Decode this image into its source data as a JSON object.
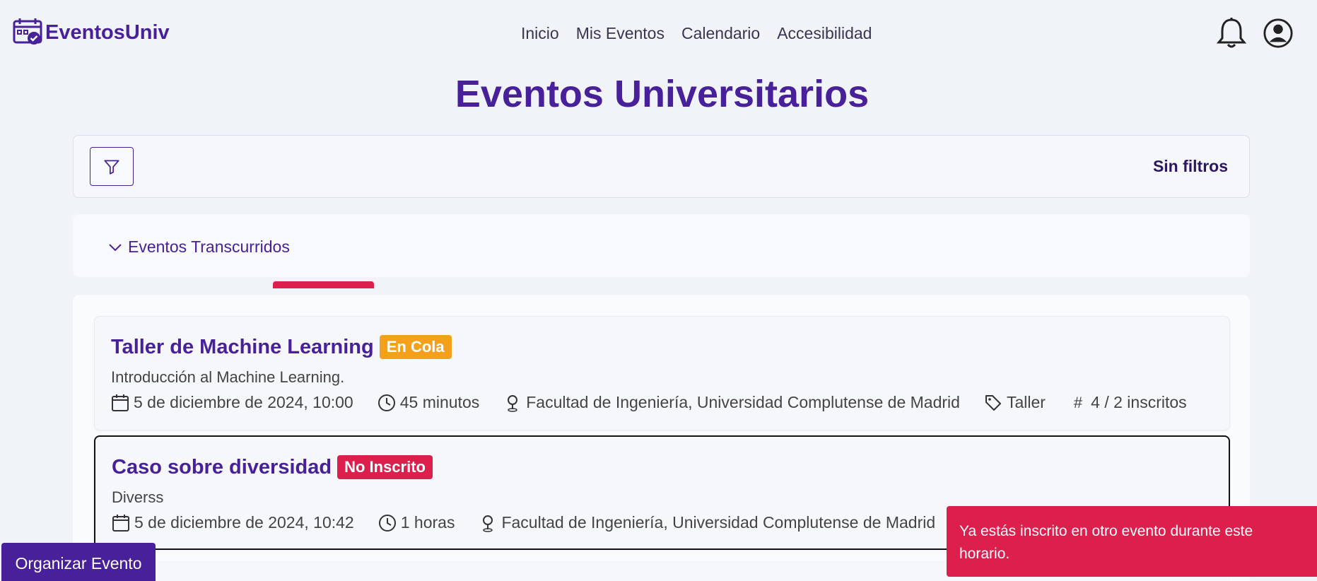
{
  "brand": {
    "name": "EventosUniv",
    "color": "#47209a"
  },
  "nav": {
    "links": [
      "Inicio",
      "Mis Eventos",
      "Calendario",
      "Accesibilidad"
    ]
  },
  "page": {
    "title": "Eventos Universitarios"
  },
  "filters": {
    "status": "Sin filtros"
  },
  "past": {
    "label": "Eventos Transcurridos"
  },
  "events": [
    {
      "title": "Taller de Machine Learning",
      "badge": "En Cola",
      "badge_color": "#f4a01a",
      "description": "Introducción al Machine Learning.",
      "date": "5 de diciembre de 2024, 10:00",
      "duration": "45 minutos",
      "location": "Facultad de Ingeniería, Universidad Complutense de Madrid",
      "category": "Taller",
      "capacity": "4 / 2 inscritos"
    },
    {
      "title": "Caso sobre diversidad",
      "badge": "No Inscrito",
      "badge_color": "#dc1f4c",
      "description": "Diverss",
      "date": "5 de diciembre de 2024, 10:42",
      "duration": "1 horas",
      "location": "Facultad de Ingeniería, Universidad Complutense de Madrid"
    }
  ],
  "actions": {
    "organize": "Organizar Evento"
  },
  "toast": {
    "message": "Ya estás inscrito en otro evento durante este horario.",
    "color": "#dc1f4c"
  },
  "icons": {
    "brand": "calendar-check-icon",
    "bell": "bell-icon",
    "user": "user-circle-icon",
    "filter": "filter-icon",
    "chevron": "chevron-down-icon",
    "date": "calendar-icon",
    "duration": "clock-icon",
    "location": "map-pin-icon",
    "category": "tag-icon",
    "capacity": "hash-icon"
  }
}
